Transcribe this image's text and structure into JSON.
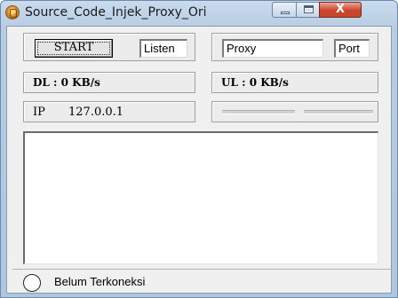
{
  "window": {
    "title": "Source_Code_Injek_Proxy_Ori",
    "icon": "app-icon"
  },
  "controls": {
    "minimize": "minimize-icon",
    "maximize": "maximize-icon",
    "close_label": "X"
  },
  "connection": {
    "start_label": "START",
    "listen_value": "Listen",
    "proxy_value": "Proxy",
    "port_value": "Port"
  },
  "stats": {
    "dl": "DL : 0 KB/s",
    "ul": "UL : 0 KB/s",
    "ip_label": "IP",
    "ip_value": "127.0.0.1",
    "dl_bar_progress": 0,
    "ul_bar_progress": 0
  },
  "log": {
    "content": ""
  },
  "status": {
    "icon": "status-indicator-icon",
    "text": "Belum Terkoneksi"
  },
  "colors": {
    "titlebar": "#b8cde3",
    "close_button": "#c9462c",
    "client_background": "#f0f0f0"
  }
}
